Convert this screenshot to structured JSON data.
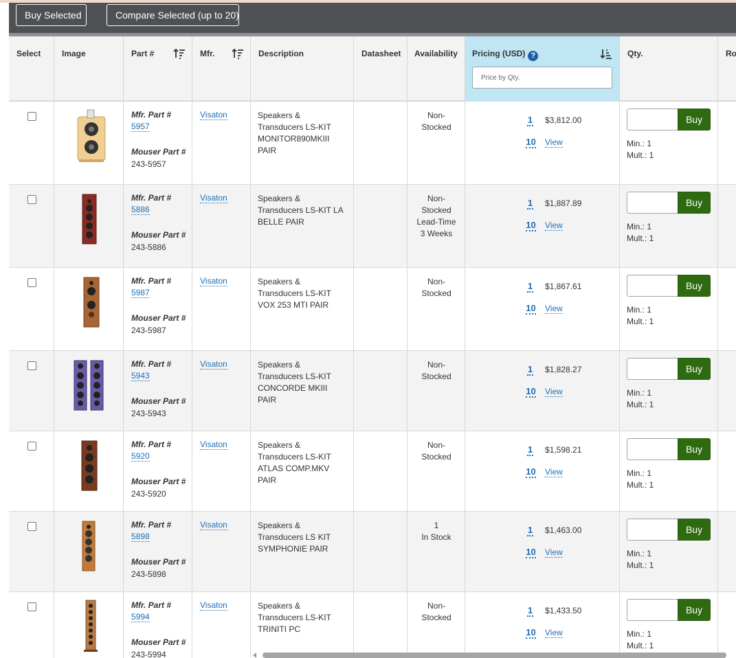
{
  "toolbar": {
    "buy_selected": "Buy Selected",
    "compare_selected": "Compare Selected (up to 20)"
  },
  "headers": {
    "select": "Select",
    "image": "Image",
    "part": "Part #",
    "mfr": "Mfr.",
    "description": "Description",
    "datasheet": "Datasheet",
    "availability": "Availability",
    "pricing": "Pricing (USD)",
    "help_glyph": "?",
    "price_placeholder": "Price by Qty.",
    "qty": "Qty.",
    "ro": "Ro"
  },
  "labels": {
    "mfr_part": "Mfr. Part #",
    "mouser_part": "Mouser Part #",
    "view": "View",
    "buy": "Buy",
    "min": "Min.: 1",
    "mult": "Mult.: 1"
  },
  "colors": {
    "toolbar_bg": "#4d5154",
    "pricing_header_bg": "#bfe6f2",
    "link": "#1f6fb5",
    "buy_button": "#2e6b10",
    "row_alt": "#f3f3f3"
  },
  "products": [
    {
      "mfr_part": "5957",
      "mouser_part": "243-5957",
      "mfr": "Visaton",
      "description": [
        "Speakers &",
        "Transducers LS-KIT",
        "MONITOR890MKIII",
        "PAIR"
      ],
      "availability": [
        "Non-",
        "Stocked"
      ],
      "qty1": "1",
      "price1": "$3,812.00",
      "qty10": "10"
    },
    {
      "mfr_part": "5886",
      "mouser_part": "243-5886",
      "mfr": "Visaton",
      "description": [
        "Speakers &",
        "Transducers LS-KIT LA",
        "BELLE PAIR"
      ],
      "availability": [
        "Non-",
        "Stocked",
        "Lead-Time",
        "3 Weeks"
      ],
      "qty1": "1",
      "price1": "$1,887.89",
      "qty10": "10"
    },
    {
      "mfr_part": "5987",
      "mouser_part": "243-5987",
      "mfr": "Visaton",
      "description": [
        "Speakers &",
        "Transducers LS-KIT",
        "VOX 253 MTI PAIR"
      ],
      "availability": [
        "Non-",
        "Stocked"
      ],
      "qty1": "1",
      "price1": "$1,867.61",
      "qty10": "10"
    },
    {
      "mfr_part": "5943",
      "mouser_part": "243-5943",
      "mfr": "Visaton",
      "description": [
        "Speakers &",
        "Transducers LS-KIT",
        "CONCORDE MKIII",
        "PAIR"
      ],
      "availability": [
        "Non-",
        "Stocked"
      ],
      "qty1": "1",
      "price1": "$1,828.27",
      "qty10": "10"
    },
    {
      "mfr_part": "5920",
      "mouser_part": "243-5920",
      "mfr": "Visaton",
      "description": [
        "Speakers &",
        "Transducers LS-KIT",
        "ATLAS COMP.MKV",
        "PAIR"
      ],
      "availability": [
        "Non-",
        "Stocked"
      ],
      "qty1": "1",
      "price1": "$1,598.21",
      "qty10": "10"
    },
    {
      "mfr_part": "5898",
      "mouser_part": "243-5898",
      "mfr": "Visaton",
      "description": [
        "Speakers &",
        "Transducers LS KIT",
        "SYMPHONIE PAIR"
      ],
      "availability": [
        "1",
        "In Stock"
      ],
      "qty1": "1",
      "price1": "$1,463.00",
      "qty10": "10"
    },
    {
      "mfr_part": "5994",
      "mouser_part": "243-5994",
      "mfr": "Visaton",
      "description": [
        "Speakers &",
        "Transducers LS-KIT",
        "TRINITI PC"
      ],
      "availability": [
        "Non-",
        "Stocked"
      ],
      "qty1": "1",
      "price1": "$1,433.50",
      "qty10": "10"
    }
  ]
}
